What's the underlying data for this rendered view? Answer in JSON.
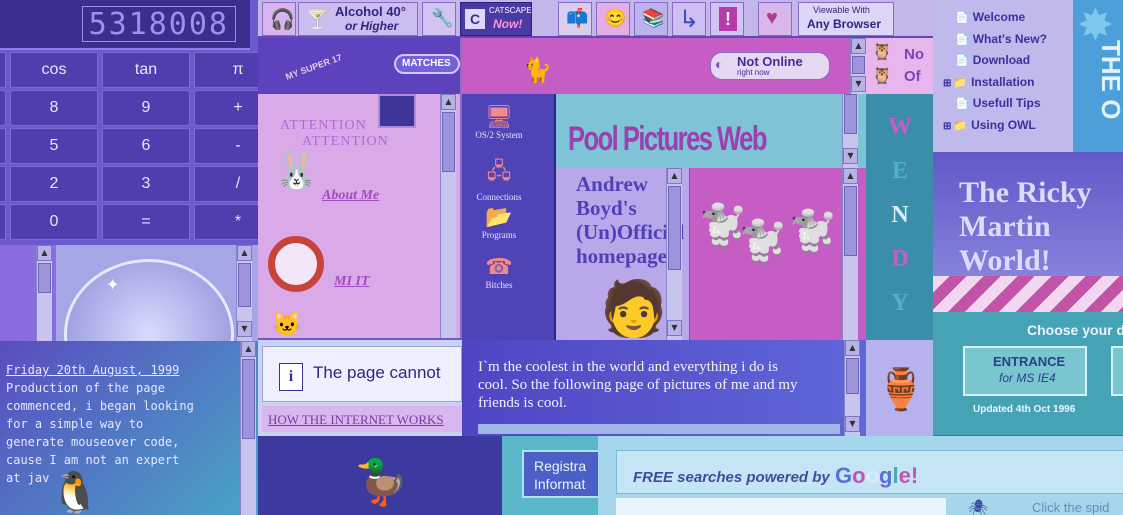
{
  "calculator": {
    "display": "5318008",
    "keys": [
      {
        "label": "cos"
      },
      {
        "label": "tan"
      },
      {
        "label": "π"
      },
      {
        "label": "8"
      },
      {
        "label": "9"
      },
      {
        "label": "+"
      },
      {
        "label": "5"
      },
      {
        "label": "6"
      },
      {
        "label": "-"
      },
      {
        "label": "2"
      },
      {
        "label": "3"
      },
      {
        "label": "/"
      },
      {
        "label": "0"
      },
      {
        "label": "="
      },
      {
        "label": "*"
      }
    ]
  },
  "toolbar_badges": {
    "alcohol_line1": "Alcohol 40°",
    "alcohol_line2": "or Higher",
    "catscape_line1": "CATSCAPE",
    "catscape_line2": "Now!",
    "viewable_line1": "Viewable With",
    "viewable_line2": "Any Browser"
  },
  "site_nav": {
    "items": [
      {
        "label": "Welcome"
      },
      {
        "label": "What's New?"
      },
      {
        "label": "Download"
      },
      {
        "label": "Installation"
      },
      {
        "label": "Usefull Tips"
      },
      {
        "label": "Using OWL"
      }
    ]
  },
  "tiny_site": {
    "matches_label": "MATCHES",
    "super_text": "MY SUPER 17",
    "warning_line1": "ATTENTION",
    "warning_line2": "ATTENTION",
    "about_link": "About Me",
    "mit_link": "MI IT"
  },
  "status_widget": {
    "title": "Not Online",
    "subtitle": "right now"
  },
  "right_logo": {
    "line1": "No",
    "line2": "Of"
  },
  "desktop_icons": [
    {
      "label": "OS/2 System"
    },
    {
      "label": "Connections"
    },
    {
      "label": "Programs"
    },
    {
      "label": "Bitches"
    }
  ],
  "banner": {
    "text": "Pool Pictures Web"
  },
  "andrew_page": {
    "title": "Andrew Boyd's (Un)Official homepage"
  },
  "wendy": {
    "letters": [
      "W",
      "E",
      "N",
      "D",
      "Y"
    ]
  },
  "ricky": {
    "title": "The Ricky Martin World!"
  },
  "owl_logo": {
    "text": "THE O"
  },
  "ie4_panel": {
    "heading": "Choose your d",
    "entrance_line1": "ENTRANCE",
    "entrance_line2": "for MS IE4",
    "updated": "Updated 4th Oct 1996"
  },
  "diary": {
    "date": "Friday 20th August, 1999",
    "lines": [
      "Production of the page",
      "commenced, i began looking",
      "for a simple way to",
      "generate mouseover code,",
      "cause I am not an expert",
      "at jav"
    ]
  },
  "error_panel": {
    "message": "The page cannot",
    "link": "HOW THE INTERNET WORKS"
  },
  "coolest": {
    "text": "I`m the coolest in the world and everything i do is cool. So the following page of pictures of me and my friends is cool."
  },
  "registration": {
    "line1": "Registra",
    "line2": "Informat"
  },
  "search": {
    "prefix": "FREE searches powered by",
    "brand_parts": [
      "G",
      "o",
      "o",
      "g",
      "l",
      "e",
      "!"
    ],
    "spider_text": "Click the spid"
  },
  "colors": {
    "accent_purple": "#7b52d9",
    "magenta": "#c85bc8",
    "teal": "#3fa6b0",
    "deep_blue": "#3b2f9a"
  }
}
